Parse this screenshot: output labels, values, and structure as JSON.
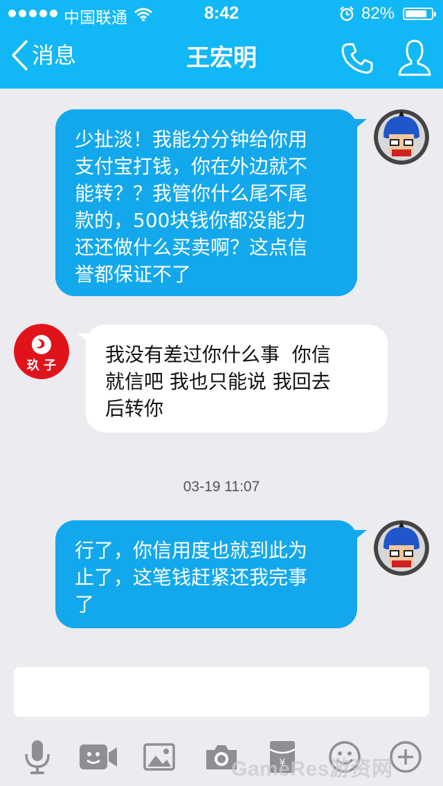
{
  "status_bar": {
    "carrier": "中国联通",
    "time": "8:42",
    "battery": "82%",
    "battery_level": 0.82
  },
  "nav": {
    "back_label": "消息",
    "title": "王宏明"
  },
  "messages": [
    {
      "side": "out",
      "text": "少扯淡！我能分分钟给你用\n支付宝打钱，你在外边就不\n能转？？我管你什么尾不尾\n款的，500块钱你都没能力\n还还做什么买卖啊？这点信\n誉都保证不了"
    },
    {
      "side": "in",
      "text": "我没有差过你什么事  你信\n就信吧 我也只能说 我回去\n后转你"
    },
    {
      "side": "out",
      "text": "行了，你信用度也就到此为\n止了，这笔钱赶紧还我完事\n了"
    }
  ],
  "timestamp": "03-19 11:07",
  "contact_avatar_text": "玖 子",
  "watermark": "GameRes游资网",
  "colors": {
    "header": "#12b7f5",
    "outgoing_bubble": "#13a8ec",
    "background": "#ebebf0"
  },
  "toolbar_icons": [
    "microphone-icon",
    "video-icon",
    "image-icon",
    "camera-icon",
    "red-packet-icon",
    "emoji-icon",
    "plus-icon"
  ]
}
